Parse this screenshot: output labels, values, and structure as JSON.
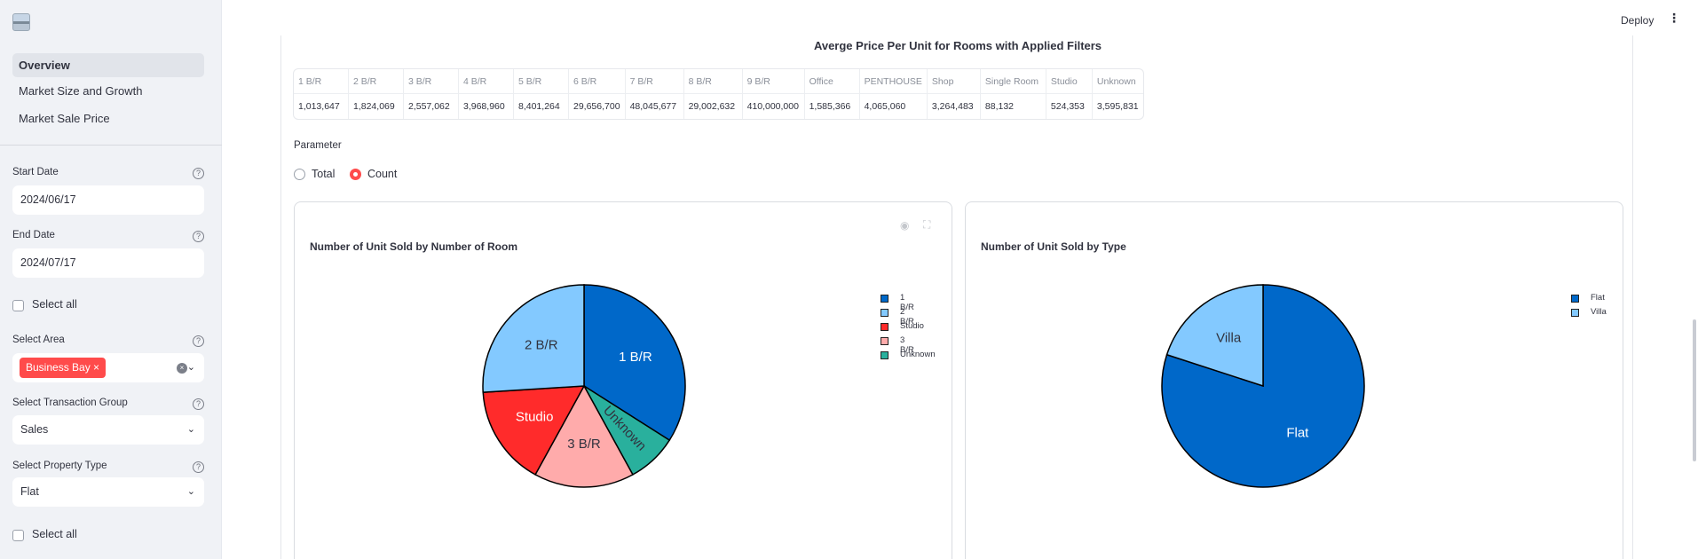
{
  "sidebar": {
    "logo_icon": "app-logo-icon",
    "nav": [
      {
        "label": "Overview",
        "active": true
      },
      {
        "label": "Market Size and Growth",
        "active": false
      },
      {
        "label": "Market Sale Price",
        "active": false
      }
    ],
    "start_date_label": "Start Date",
    "start_date": "2024/06/17",
    "end_date_label": "End Date",
    "end_date": "2024/07/17",
    "select_all_1": "Select all",
    "area_label": "Select Area",
    "area_tag": "Business Bay",
    "transaction_label": "Select Transaction Group",
    "transaction_value": "Sales",
    "property_label": "Select Property Type",
    "property_value": "Flat",
    "select_all_2": "Select all",
    "help_glyph": "?",
    "close_glyph": "×",
    "chevron_glyph": "⌄"
  },
  "header": {
    "deploy_label": "Deploy",
    "menu_glyph": "⋮"
  },
  "price_table": {
    "title": "Averge Price Per Unit for Rooms with Applied Filters",
    "columns": [
      "1 B/R",
      "2 B/R",
      "3 B/R",
      "4 B/R",
      "5 B/R",
      "6 B/R",
      "7 B/R",
      "8 B/R",
      "9 B/R",
      "Office",
      "PENTHOUSE",
      "Shop",
      "Single Room",
      "Studio",
      "Unknown"
    ],
    "values": [
      "1,013,647",
      "1,824,069",
      "2,557,062",
      "3,968,960",
      "8,401,264",
      "29,656,700",
      "48,045,677",
      "29,002,632",
      "410,000,000",
      "1,585,366",
      "4,065,060",
      "3,264,483",
      "88,132",
      "524,353",
      "3,595,831"
    ]
  },
  "parameter": {
    "label": "Parameter",
    "options": [
      "Total",
      "Count"
    ],
    "selected": "Count"
  },
  "colors": {
    "accent": "#ff4b4b"
  },
  "chart_data": [
    {
      "type": "pie",
      "title": "Number of  Unit Sold by Number of Room",
      "labels": [
        "1 B/R",
        "Unknown",
        "3 B/R",
        "Studio",
        "2 B/R"
      ],
      "values": [
        34,
        8,
        16,
        16,
        26
      ],
      "colors": [
        "#0068c9",
        "#29b09d",
        "#ffabab",
        "#ff2b2b",
        "#83c9ff"
      ],
      "text_colors": [
        "#ffffff",
        "#31333f",
        "#31333f",
        "#ffffff",
        "#31333f"
      ],
      "legend": [
        "1 B/R",
        "2 B/R",
        "Studio",
        "3 B/R",
        "Unknown"
      ],
      "legend_colors": [
        "#0068c9",
        "#83c9ff",
        "#ff2b2b",
        "#ffabab",
        "#29b09d"
      ],
      "legend_position": "right"
    },
    {
      "type": "pie",
      "title": "Number of  Unit Sold by Type",
      "labels": [
        "Flat",
        "Villa"
      ],
      "values": [
        80,
        20
      ],
      "colors": [
        "#0068c9",
        "#83c9ff"
      ],
      "text_colors": [
        "#ffffff",
        "#31333f"
      ],
      "legend": [
        "Flat",
        "Villa"
      ],
      "legend_colors": [
        "#0068c9",
        "#83c9ff"
      ],
      "legend_position": "right"
    }
  ]
}
